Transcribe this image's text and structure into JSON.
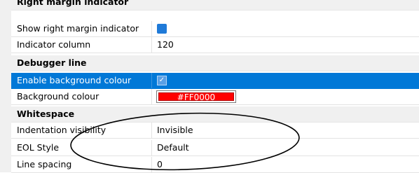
{
  "categories": {
    "right_margin": "Right margin indicator",
    "debugger_line": "Debugger line",
    "whitespace": "Whitespace"
  },
  "rows": {
    "show_right_margin": {
      "label": "Show right margin indicator",
      "checked": true
    },
    "indicator_column": {
      "label": "Indicator column",
      "value": "120"
    },
    "enable_background": {
      "label": "Enable background colour",
      "checked": true
    },
    "background_colour": {
      "label": "Background colour",
      "value": "#FF0000",
      "color": "#ff0000"
    },
    "indentation_visibility": {
      "label": "Indentation visibility",
      "value": "Invisible"
    },
    "eol_style": {
      "label": "EOL Style",
      "value": "Default"
    },
    "line_spacing": {
      "label": "Line spacing",
      "value": "0"
    }
  },
  "colors": {
    "selection": "#0078d7",
    "category_bg": "#f0f0f0",
    "annotation": "#000000"
  },
  "checkmark_glyph": "✓"
}
